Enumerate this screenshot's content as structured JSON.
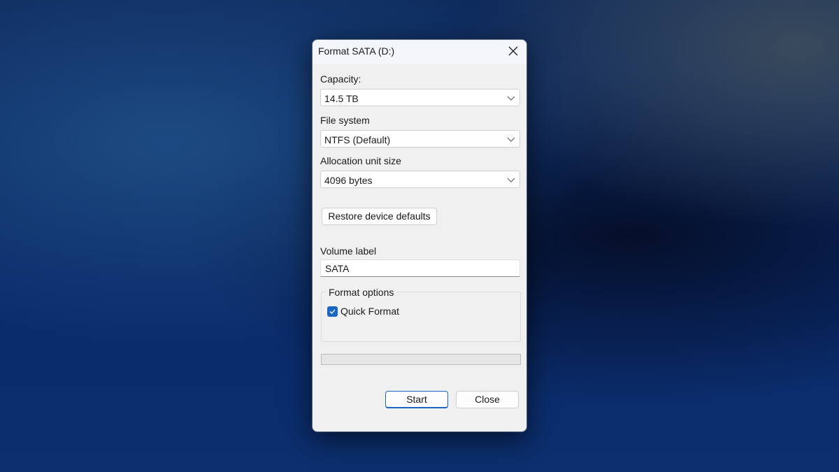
{
  "dialog": {
    "title": "Format SATA (D:)",
    "capacity": {
      "label": "Capacity:",
      "value": "14.5 TB"
    },
    "file_system": {
      "label": "File system",
      "value": "NTFS (Default)"
    },
    "allocation": {
      "label": "Allocation unit size",
      "value": "4096 bytes"
    },
    "restore_label": "Restore device defaults",
    "volume": {
      "label": "Volume label",
      "value": "SATA"
    },
    "format_options": {
      "legend": "Format options",
      "quick_format": {
        "label": "Quick Format",
        "checked": true
      }
    },
    "progress": 0,
    "start_label": "Start",
    "close_label": "Close",
    "accent": "#1a66c2"
  }
}
